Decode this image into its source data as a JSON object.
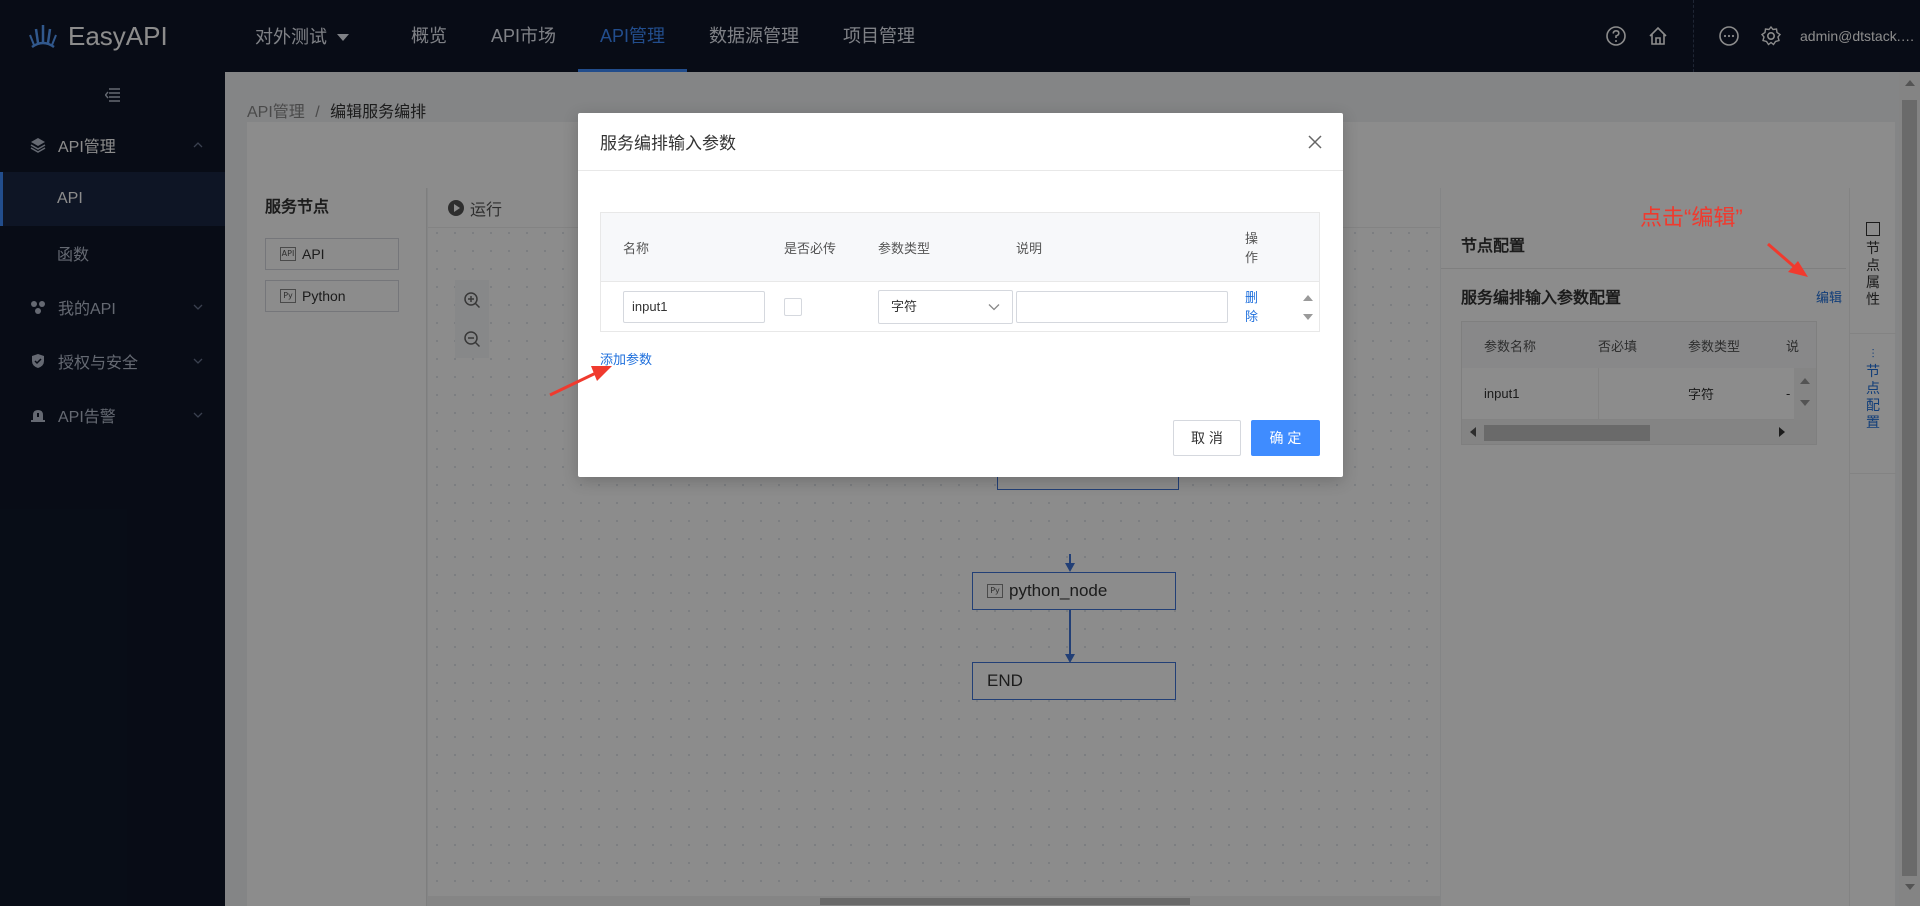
{
  "app": {
    "name": "EasyAPI"
  },
  "topnav": {
    "tenant": "对外测试",
    "items": [
      "概览",
      "API市场",
      "API管理",
      "数据源管理",
      "项目管理"
    ],
    "active": "API管理",
    "user": "admin@dtstack.com"
  },
  "sidebar": {
    "items": [
      {
        "label": "API管理",
        "icon": "layers-icon",
        "open": true,
        "children": [
          "API",
          "函数"
        ]
      },
      {
        "label": "我的API",
        "icon": "apps-icon"
      },
      {
        "label": "授权与安全",
        "icon": "shield-icon"
      },
      {
        "label": "API告警",
        "icon": "alarm-icon"
      }
    ],
    "active_child": "API"
  },
  "breadcrumb": {
    "root": "API管理",
    "separator": "/",
    "current": "编辑服务编排"
  },
  "service_nodes": {
    "title": "服务节点",
    "nodes": [
      {
        "label": "API",
        "badge": "API"
      },
      {
        "label": "Python",
        "badge": "Py"
      }
    ]
  },
  "canvas": {
    "run_label": "运行",
    "nodes": [
      {
        "label": "python_node",
        "badge": "Py"
      },
      {
        "label": "END"
      }
    ]
  },
  "node_config": {
    "title": "节点配置",
    "subtitle": "服务编排输入参数配置",
    "edit_link": "编辑",
    "columns": [
      "参数名称",
      "否必填",
      "参数类型",
      "说"
    ],
    "rows": [
      {
        "name": "input1",
        "required": "",
        "type": "字符",
        "desc": "-"
      }
    ]
  },
  "side_tabs": [
    "节点属性",
    "节点配置"
  ],
  "annotation": {
    "text": "点击“编辑”",
    "color": "#f03a2e"
  },
  "modal": {
    "title": "服务编排输入参数",
    "columns": {
      "name": "名称",
      "required": "是否必传",
      "type": "参数类型",
      "desc": "说明",
      "op": "操作"
    },
    "row": {
      "name": "input1",
      "required": false,
      "type": "字符",
      "desc": "",
      "op": "删除"
    },
    "add_param": "添加参数",
    "cancel": "取 消",
    "ok": "确 定"
  },
  "colors": {
    "accent": "#3f8cff",
    "nav_bg": "#0f1729",
    "link": "#1e6fdc",
    "annotation": "#f03a2e"
  }
}
